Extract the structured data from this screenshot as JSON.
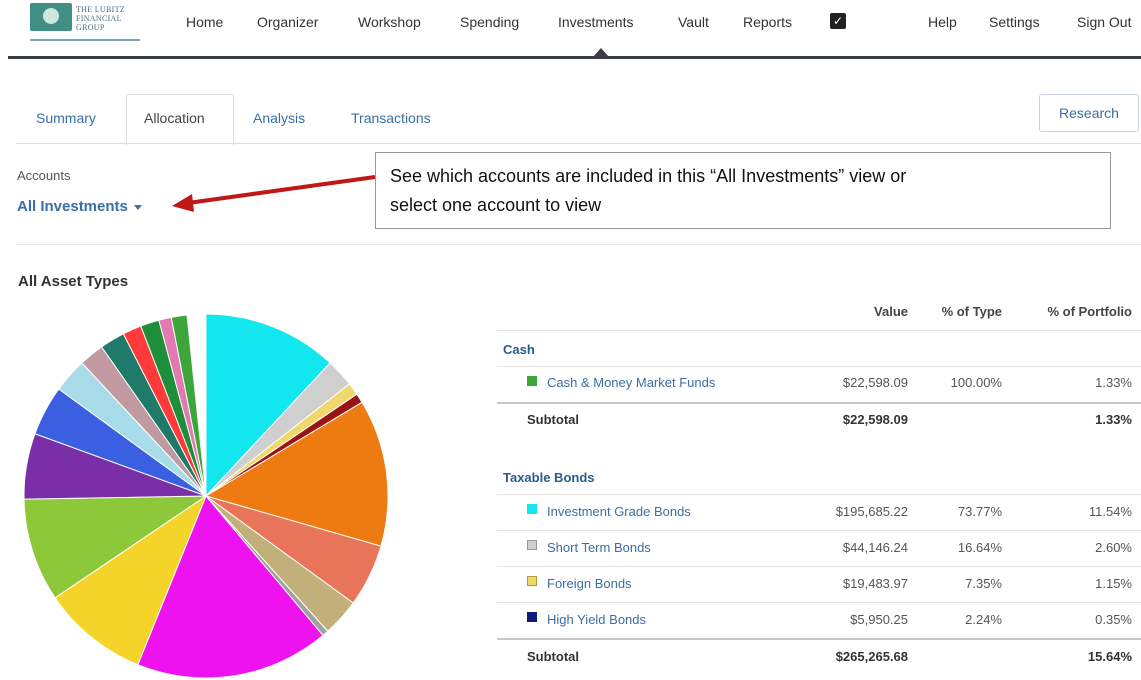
{
  "logo": {
    "line1": "THE LUBITZ",
    "line2": "FINANCIAL",
    "line3": "GROUP"
  },
  "nav": {
    "items": [
      "Home",
      "Organizer",
      "Workshop",
      "Spending",
      "Investments",
      "Vault",
      "Reports"
    ],
    "right": [
      "Help",
      "Settings",
      "Sign Out"
    ],
    "active": "Investments",
    "check_icon": "check-icon"
  },
  "tabs": [
    "Summary",
    "Allocation",
    "Analysis",
    "Transactions"
  ],
  "active_tab": "Allocation",
  "research_label": "Research",
  "accounts": {
    "label": "Accounts",
    "value": "All Investments"
  },
  "callout": {
    "line1": "See which accounts are included in this “All Investments” view or",
    "line2": "select one account to view"
  },
  "asset_title": "All Asset Types",
  "table": {
    "headers": [
      "Value",
      "% of Type",
      "% of Portfolio"
    ],
    "groups": [
      {
        "name": "Cash",
        "rows": [
          {
            "name": "Cash & Money Market Funds",
            "value": "$22,598.09",
            "pct_type": "100.00%",
            "pct_portfolio": "1.33%",
            "color": "#3da63a"
          }
        ],
        "subtotal": {
          "label": "Subtotal",
          "value": "$22,598.09",
          "pct_portfolio": "1.33%"
        }
      },
      {
        "name": "Taxable Bonds",
        "rows": [
          {
            "name": "Investment Grade Bonds",
            "value": "$195,685.22",
            "pct_type": "73.77%",
            "pct_portfolio": "11.54%",
            "color": "#12e6ee"
          },
          {
            "name": "Short Term Bonds",
            "value": "$44,146.24",
            "pct_type": "16.64%",
            "pct_portfolio": "2.60%",
            "color": "#cfcfcf"
          },
          {
            "name": "Foreign Bonds",
            "value": "$19,483.97",
            "pct_type": "7.35%",
            "pct_portfolio": "1.15%",
            "color": "#f0d86a"
          },
          {
            "name": "High Yield Bonds",
            "value": "$5,950.25",
            "pct_type": "2.24%",
            "pct_portfolio": "0.35%",
            "color": "#0e1a7a"
          }
        ],
        "subtotal": {
          "label": "Subtotal",
          "value": "$265,265.68",
          "pct_portfolio": "15.64%"
        }
      }
    ]
  },
  "pie_slices": [
    {
      "color": "#12e6ee",
      "deg": 43
    },
    {
      "color": "#cfcfcf",
      "deg": 9
    },
    {
      "color": "#f0d86a",
      "deg": 4
    },
    {
      "color": "#9a1414",
      "deg": 3
    },
    {
      "color": "#ee7a12",
      "deg": 47
    },
    {
      "color": "#e8745a",
      "deg": 20
    },
    {
      "color": "#c2b07a",
      "deg": 12
    },
    {
      "color": "#a0a0a0",
      "deg": 2
    },
    {
      "color": "#ee12ee",
      "deg": 62
    },
    {
      "color": "#f4d428",
      "deg": 34
    },
    {
      "color": "#8cc83a",
      "deg": 33
    },
    {
      "color": "#7a2fa8",
      "deg": 21
    },
    {
      "color": "#3a5fe0",
      "deg": 16
    },
    {
      "color": "#a8dce8",
      "deg": 11
    },
    {
      "color": "#c09aa0",
      "deg": 8
    },
    {
      "color": "#1f7a6a",
      "deg": 8
    },
    {
      "color": "#ff3a3a",
      "deg": 6
    },
    {
      "color": "#1e8e3a",
      "deg": 6
    },
    {
      "color": "#e07ab0",
      "deg": 4
    },
    {
      "color": "#3da63a",
      "deg": 5
    }
  ]
}
